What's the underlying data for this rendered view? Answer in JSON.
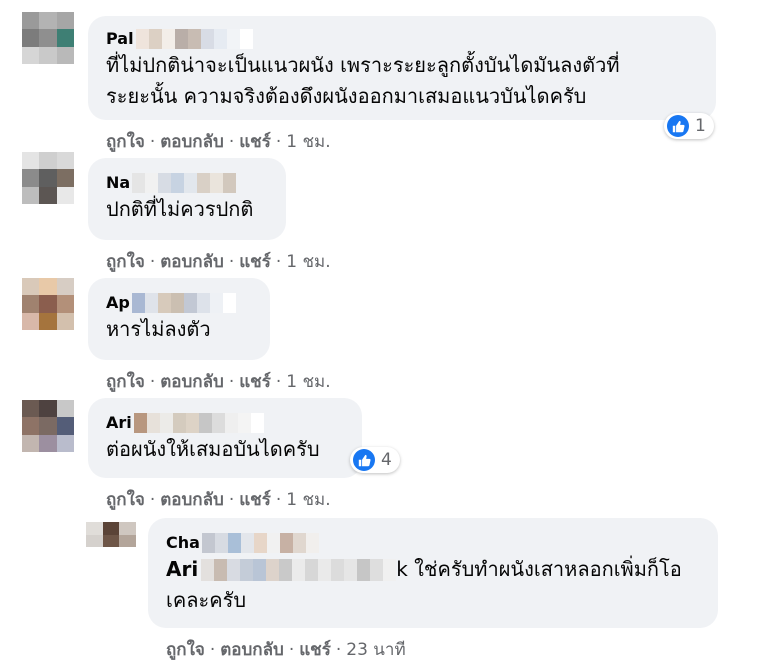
{
  "comments": [
    {
      "author_visible": "Pal",
      "text_line1": "ที่ไม่ปกติน่าจะเป็นแนวผนัง เพราะระยะลูกตั้งบันไดมันลงตัวที่",
      "text_line2": "ระยะนั้น ความจริงต้องดึงผนังออกมาเสมอแนวบันไดครับ",
      "like_label": "ถูกใจ",
      "reply_label": "ตอบกลับ",
      "share_label": "แชร์",
      "time": "1 ชม.",
      "reaction_count": "1"
    },
    {
      "author_visible": "Na",
      "text_line1": "ปกติที่ไม่ควรปกติ",
      "like_label": "ถูกใจ",
      "reply_label": "ตอบกลับ",
      "share_label": "แชร์",
      "time": "1 ชม."
    },
    {
      "author_visible": "Ap",
      "text_line1": "หารไม่ลงตัว",
      "like_label": "ถูกใจ",
      "reply_label": "ตอบกลับ",
      "share_label": "แชร์",
      "time": "1 ชม."
    },
    {
      "author_visible": "Ari",
      "text_line1": "ต่อผนังให้เสมอบันไดครับ",
      "like_label": "ถูกใจ",
      "reply_label": "ตอบกลับ",
      "share_label": "แชร์",
      "time": "1 ชม.",
      "reaction_count": "4"
    }
  ],
  "reply": {
    "author_visible": "Cha",
    "mention_visible": "Ari",
    "text_line1_tail": "k ใช่ครับทำผนังเสาหลอกเพิ่มก็โอ",
    "text_line2": "เคละครับ",
    "like_label": "ถูกใจ",
    "reply_label": "ตอบกลับ",
    "share_label": "แชร์",
    "time": "23 นาที"
  },
  "separator": "·",
  "colors": {
    "bubble": "#f0f2f5",
    "meta": "#65676b",
    "like_blue": "#1877f2"
  },
  "icons": {
    "reaction": "like-thumb-icon"
  }
}
